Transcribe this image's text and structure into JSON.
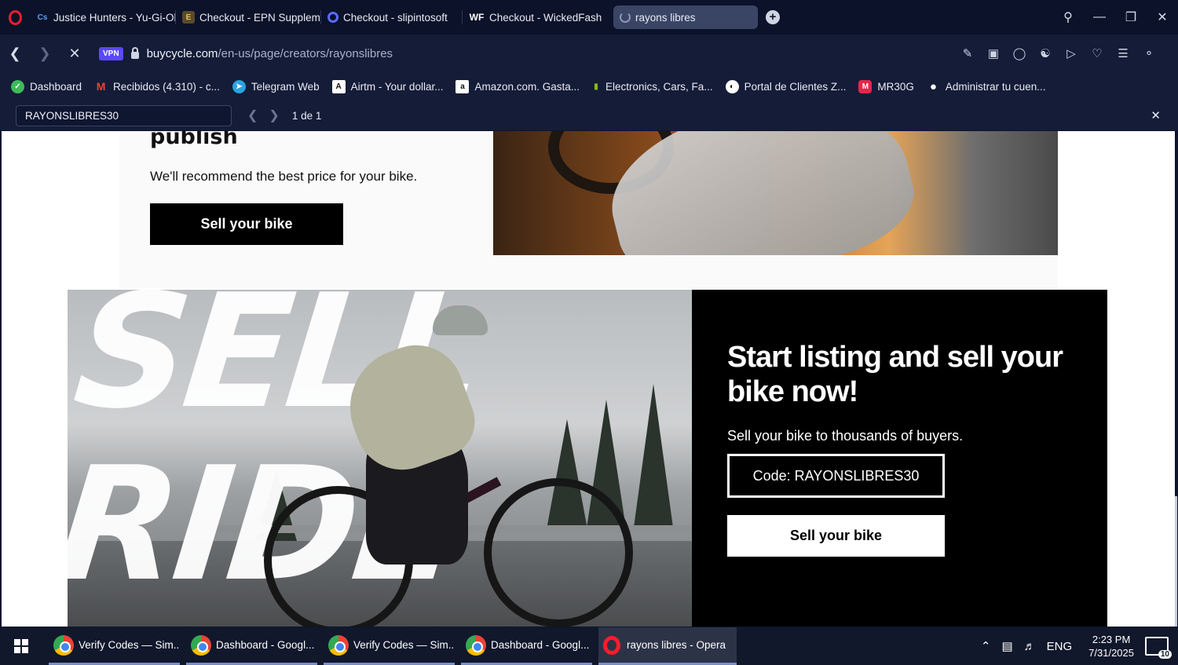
{
  "browser": {
    "tabs": [
      {
        "title": "Justice Hunters - Yu-Gi-Oh",
        "icon": "cs-icon",
        "active": false
      },
      {
        "title": "Checkout - EPN Suppleme",
        "icon": "epn-icon",
        "active": false
      },
      {
        "title": "Checkout - slipintosoft",
        "icon": "slipintosoft-icon",
        "active": false
      },
      {
        "title": "Checkout - WickedFash",
        "icon": "wf-icon",
        "active": false
      },
      {
        "title": "rayons libres",
        "icon": "loading-spinner-icon",
        "active": true
      }
    ],
    "address": {
      "vpn_label": "VPN",
      "url_host": "buycycle.com",
      "url_path": "/en-us/page/creators/rayonslibres"
    },
    "bookmarks": [
      {
        "label": "Dashboard",
        "color": "#3dbb5a",
        "glyph": "✓"
      },
      {
        "label": "Recibidos (4.310) - c...",
        "color": "#ea4335",
        "glyph": "M"
      },
      {
        "label": "Telegram Web",
        "color": "#2aa3e0",
        "glyph": "➤"
      },
      {
        "label": "Airtm - Your dollar...",
        "color": "#ffffff",
        "glyph": "A"
      },
      {
        "label": "Amazon.com. Gasta...",
        "color": "#ffffff",
        "glyph": "a"
      },
      {
        "label": "Electronics, Cars, Fa...",
        "color": "#86b817",
        "glyph": "e"
      },
      {
        "label": "Portal de Clientes Z...",
        "color": "#ffffff",
        "glyph": "◐"
      },
      {
        "label": "MR30G",
        "color": "#e6264b",
        "glyph": "M"
      },
      {
        "label": "Administrar tu cuen...",
        "color": "#ffffff",
        "glyph": ""
      }
    ],
    "find": {
      "query": "RAYONSLIBRES30",
      "count": "1 de 1"
    }
  },
  "page": {
    "heading_partial": "publish",
    "recommend_text": "We'll recommend the best price for your bike.",
    "sell_button_top": "Sell your bike",
    "cta_title": "Start listing and sell your bike now!",
    "cta_subtitle": "Sell your bike to thousands of buyers.",
    "code_label": "Code: RAYONSLIBRES30",
    "sell_button_bottom": "Sell your bike",
    "photo_overlay_text": "SELL RIDE"
  },
  "taskbar": {
    "items": [
      {
        "label": "Verify Codes — Sim...",
        "app": "chrome"
      },
      {
        "label": "Dashboard - Googl...",
        "app": "chrome"
      },
      {
        "label": "Verify Codes — Sim...",
        "app": "chrome"
      },
      {
        "label": "Dashboard - Googl...",
        "app": "chrome"
      },
      {
        "label": "rayons libres - Opera",
        "app": "opera"
      }
    ],
    "language": "ENG",
    "time": "2:23 PM",
    "date": "7/31/2025",
    "notification_count": "10"
  }
}
